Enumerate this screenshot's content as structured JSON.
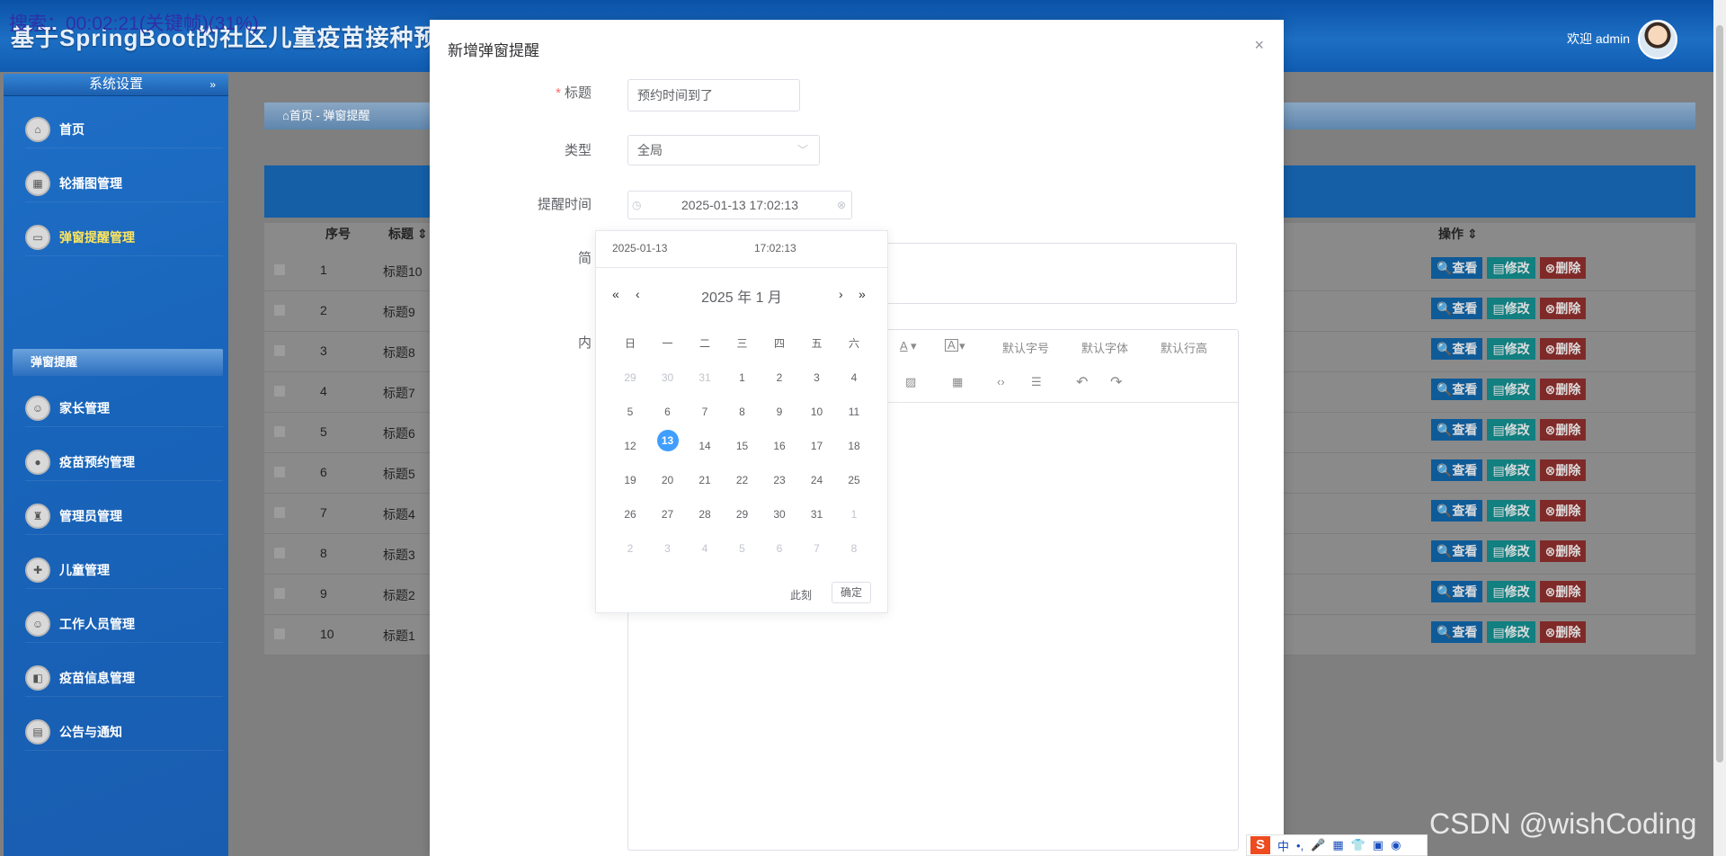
{
  "header": {
    "app_title": "基于SpringBoot的社区儿童疫苗接种预约系统",
    "welcome": "欢迎 admin"
  },
  "recording_label": "搜索：00:02:21(关键帧)(31%)",
  "sidebar": {
    "section_title": "系统设置",
    "section_arrow": "»",
    "items": [
      {
        "label": "首页",
        "icon": "⌂"
      },
      {
        "label": "轮播图管理",
        "icon": "▦"
      },
      {
        "label": "弹窗提醒管理",
        "icon": "▭"
      },
      {
        "label": "家长管理",
        "icon": "☺"
      },
      {
        "label": "疫苗预约管理",
        "icon": "●"
      },
      {
        "label": "管理员管理",
        "icon": "♜"
      },
      {
        "label": "儿童管理",
        "icon": "✚"
      },
      {
        "label": "工作人员管理",
        "icon": "☺"
      },
      {
        "label": "疫苗信息管理",
        "icon": "◧"
      },
      {
        "label": "公告与通知",
        "icon": "▤"
      }
    ],
    "sub_active": "弹窗提醒"
  },
  "breadcrumb": {
    "home": "⌂首页",
    "sep": "-",
    "current": "弹窗提醒"
  },
  "table": {
    "headers": {
      "seq": "序号",
      "title": "标题 ⇕",
      "actions": "操作 ⇕"
    },
    "rows": [
      {
        "seq": "1",
        "title": "标题10"
      },
      {
        "seq": "2",
        "title": "标题9"
      },
      {
        "seq": "3",
        "title": "标题8"
      },
      {
        "seq": "4",
        "title": "标题7"
      },
      {
        "seq": "5",
        "title": "标题6"
      },
      {
        "seq": "6",
        "title": "标题5"
      },
      {
        "seq": "7",
        "title": "标题4"
      },
      {
        "seq": "8",
        "title": "标题3"
      },
      {
        "seq": "9",
        "title": "标题2"
      },
      {
        "seq": "10",
        "title": "标题1"
      }
    ],
    "view_label": "🔍查看",
    "edit_label": "▤修改",
    "delete_label": "⊗删除"
  },
  "modal": {
    "title": "新增弹窗提醒",
    "close": "×",
    "fields": {
      "title_label": "标题",
      "title_value": "预约时间到了",
      "type_label": "类型",
      "type_value": "全局",
      "time_label": "提醒时间",
      "time_value": "2025-01-13 17:02:13",
      "intro_label": "简",
      "content_label": "内"
    },
    "editor": {
      "font_color": "A",
      "bg_color": "A",
      "font_size": "默认字号",
      "font_family": "默认字体",
      "line_height": "默认行高",
      "image": "▨",
      "table": "▦",
      "code": "‹›",
      "hr": "☰",
      "undo": "↶",
      "redo": "↷"
    }
  },
  "picker": {
    "date_field": "2025-01-13",
    "time_field": "17:02:13",
    "nav": {
      "prev_year": "«",
      "prev_month": "‹",
      "next_month": "›",
      "next_year": "»"
    },
    "month_label": "2025 年  1 月",
    "weekdays": [
      "日",
      "一",
      "二",
      "三",
      "四",
      "五",
      "六"
    ],
    "weeks": [
      [
        "29",
        "30",
        "31",
        "1",
        "2",
        "3",
        "4"
      ],
      [
        "5",
        "6",
        "7",
        "8",
        "9",
        "10",
        "11"
      ],
      [
        "12",
        "13",
        "14",
        "15",
        "16",
        "17",
        "18"
      ],
      [
        "19",
        "20",
        "21",
        "22",
        "23",
        "24",
        "25"
      ],
      [
        "26",
        "27",
        "28",
        "29",
        "30",
        "31",
        "1"
      ],
      [
        "2",
        "3",
        "4",
        "5",
        "6",
        "7",
        "8"
      ]
    ],
    "now_label": "此刻",
    "ok_label": "确定"
  },
  "watermark": "CSDN @wishCoding",
  "ime": {
    "logo": "S",
    "items": [
      "中",
      "•,",
      "🎤",
      "▦",
      "👕",
      "▣",
      "◉"
    ]
  }
}
